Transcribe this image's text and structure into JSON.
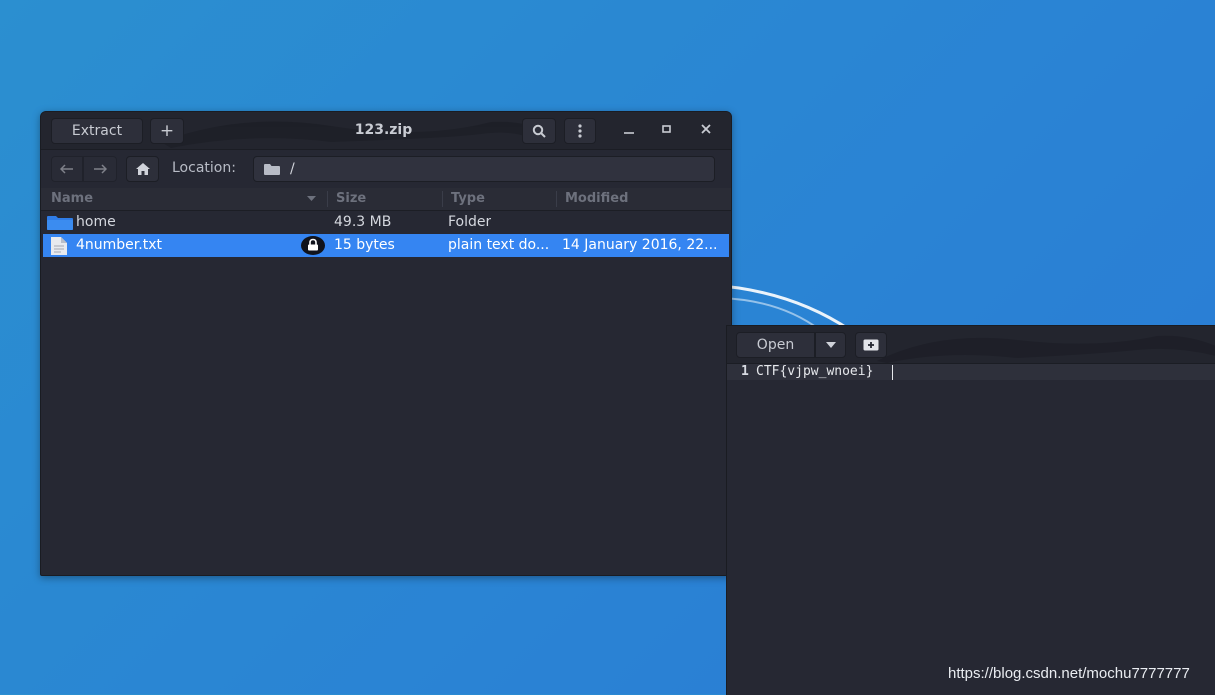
{
  "archive_window": {
    "title": "123.zip",
    "extract_label": "Extract",
    "add_label": "+",
    "location_label": "Location:",
    "location_value": "/",
    "columns": [
      "Name",
      "Size",
      "Type",
      "Modified"
    ],
    "files": [
      {
        "name": "home",
        "size": "49.3 MB",
        "type": "Folder",
        "modified": "",
        "icon": "folder-icon",
        "encrypted": false,
        "selected": false
      },
      {
        "name": "4number.txt",
        "size": "15 bytes",
        "type": "plain text do...",
        "modified": "14 January 2016, 22...",
        "icon": "text-file-icon",
        "encrypted": true,
        "selected": true
      }
    ]
  },
  "editor_window": {
    "open_label": "Open",
    "line_number": "1",
    "line_text": "CTF{vjpw_wnoei}"
  },
  "watermark": "https://blog.csdn.net/mochu7777777",
  "colors": {
    "desktop": "#2a86d3",
    "window_bg": "#262833",
    "selection": "#3585f2",
    "folder": "#2f7de8"
  }
}
